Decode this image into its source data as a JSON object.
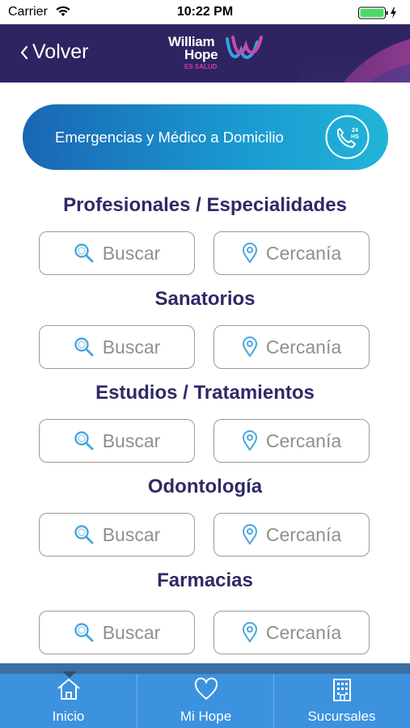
{
  "status_bar": {
    "carrier": "Carrier",
    "time": "10:22 PM",
    "battery_color": "#4cd964"
  },
  "header": {
    "back_label": "Volver",
    "logo": {
      "line1": "William",
      "line2": "Hope",
      "tagline": "ES SALUD"
    },
    "background_color": "#2e2461"
  },
  "emergency": {
    "label": "Emergencias y Médico a Domicilio",
    "icon": "phone-24hs-icon",
    "icon_text": "24 HS"
  },
  "sections": [
    {
      "title": "Profesionales / Especialidades",
      "search_label": "Buscar",
      "nearby_label": "Cercanía"
    },
    {
      "title": "Sanatorios",
      "search_label": "Buscar",
      "nearby_label": "Cercanía"
    },
    {
      "title": "Estudios / Tratamientos",
      "search_label": "Buscar",
      "nearby_label": "Cercanía"
    },
    {
      "title": "Odontología",
      "search_label": "Buscar",
      "nearby_label": "Cercanía"
    },
    {
      "title": "Farmacias",
      "search_label": "Buscar",
      "nearby_label": "Cercanía"
    }
  ],
  "tab_bar": {
    "tabs": [
      {
        "label": "Inicio",
        "icon": "home-icon",
        "selected": true
      },
      {
        "label": "Mi Hope",
        "icon": "heart-icon",
        "selected": false
      },
      {
        "label": "Sucursales",
        "icon": "building-icon",
        "selected": false
      }
    ],
    "color": "#3c92de"
  },
  "colors": {
    "accent_search_icon": "#4aa6e0",
    "title_color": "#2e2a66"
  }
}
